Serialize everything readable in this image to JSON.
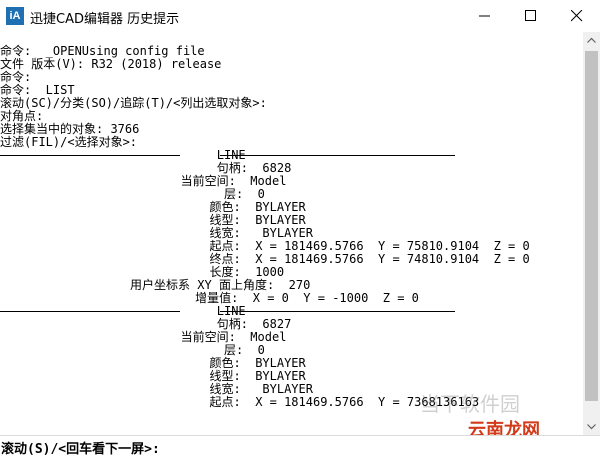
{
  "window": {
    "title": "迅捷CAD编辑器 历史提示",
    "icon_text": "iA"
  },
  "console": {
    "lines": [
      "命令:  _OPENUsing config file",
      "文件 版本(V): R32 (2018) release",
      "命令:",
      "命令:  LIST",
      "滚动(SC)/分类(SO)/追踪(T)/<列出选取对象>:",
      "对角点:",
      "选择集当中的对象: 3766",
      "过滤(FIL)/<选择对象>:",
      "                              LINE",
      "                              句柄:  6828",
      "                         当前空间:  Model",
      "                               层:  0",
      "                             颜色:  BYLAYER",
      "                             线型:  BYLAYER",
      "                             线宽:   BYLAYER",
      "                             起点:  X = 181469.5766  Y = 75810.9104  Z = 0",
      "                             终点:  X = 181469.5766  Y = 74810.9104  Z = 0",
      "                             长度:  1000",
      "                  用户坐标系 XY 面上角度:  270",
      "                           增量值:  X = 0  Y = -1000  Z = 0",
      "                              LINE",
      "                              句柄:  6827",
      "                         当前空间:  Model",
      "                               层:  0",
      "                             颜色:  BYLAYER",
      "                             线型:  BYLAYER",
      "                             线宽:   BYLAYER",
      "                             起点:  X = 181469.5766  Y = 7368136163"
    ],
    "prompt": "滚动(S)/<回车看下一屏>:"
  },
  "watermark": {
    "top": "当下软件园",
    "bottom": "云南龙网"
  }
}
